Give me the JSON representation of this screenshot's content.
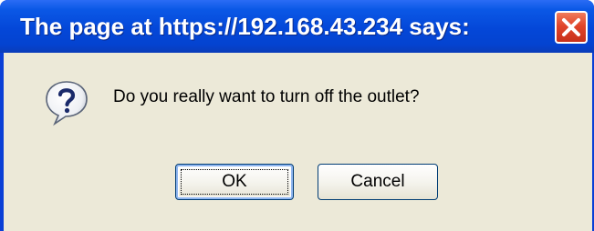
{
  "window": {
    "title": "The page at https://192.168.43.234 says:",
    "close_icon": "close-icon"
  },
  "dialog": {
    "icon": "question-icon",
    "message": "Do you really want to turn off the outlet?",
    "ok_label": "OK",
    "cancel_label": "Cancel"
  },
  "colors": {
    "titlebar": "#0447d8",
    "client_background": "#ece9d8",
    "close_button": "#e0442a"
  }
}
